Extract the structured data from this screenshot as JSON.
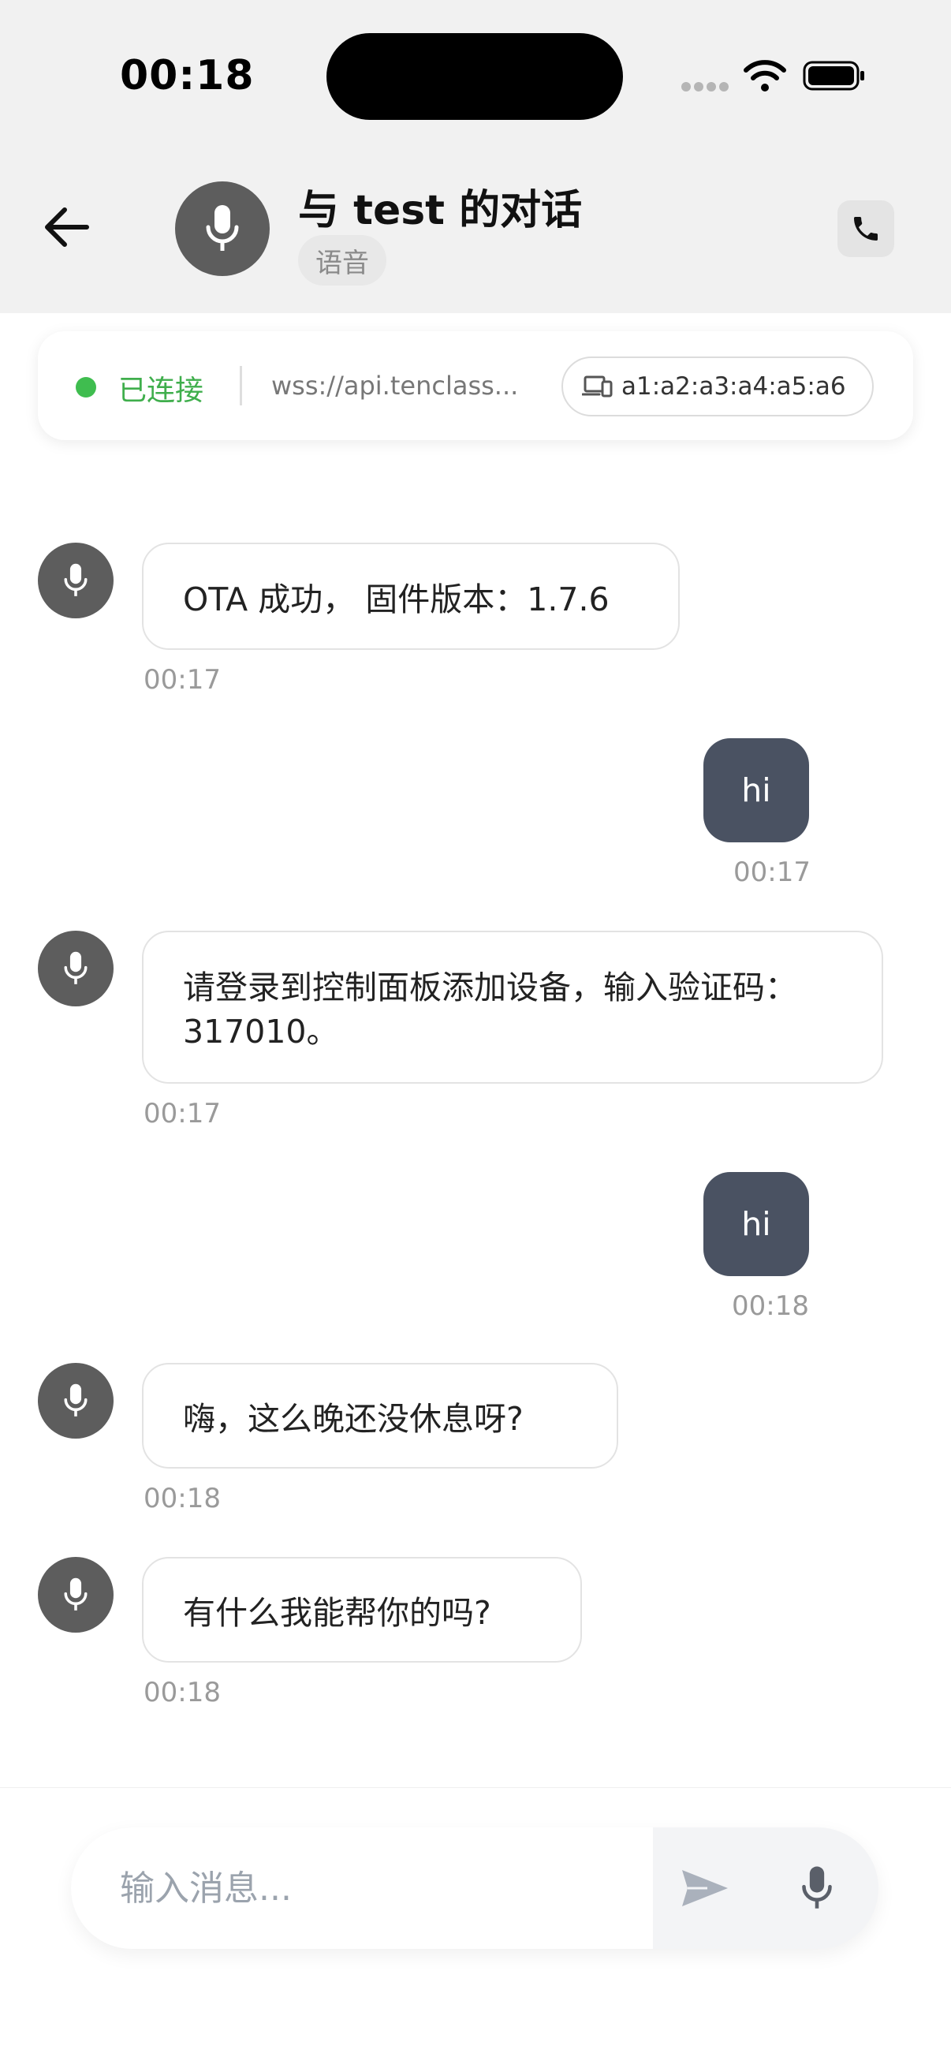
{
  "status_bar": {
    "time": "00:18"
  },
  "header": {
    "title": "与 test 的对话",
    "mode_chip": "语音",
    "icons": {
      "back": "arrow-left-icon",
      "avatar": "microphone-icon",
      "call": "phone-icon"
    }
  },
  "connection": {
    "status": "已连接",
    "status_color": "#3fbd4f",
    "url": "wss://api.tenclass...",
    "device_mac": "a1:a2:a3:a4:a5:a6",
    "device_icon": "devices-icon"
  },
  "messages": [
    {
      "from": "bot",
      "text": "OTA 成功， 固件版本：1.7.6",
      "time": "00:17"
    },
    {
      "from": "user",
      "text": "hi",
      "time": "00:17"
    },
    {
      "from": "bot",
      "text": "请登录到控制面板添加设备，输入验证码：317010。",
      "time": "00:17"
    },
    {
      "from": "user",
      "text": "hi",
      "time": "00:18"
    },
    {
      "from": "bot",
      "text": "嗨，这么晚还没休息呀?",
      "time": "00:18"
    },
    {
      "from": "bot",
      "text": "有什么我能帮你的吗?",
      "time": "00:18"
    }
  ],
  "composer": {
    "placeholder": "输入消息...",
    "icons": {
      "send": "send-icon",
      "mic": "microphone-icon"
    }
  },
  "colors": {
    "user_bubble": "#4a5262",
    "avatar_bg": "#5d5d5d",
    "header_bg": "#f1f1f1",
    "connected_green": "#3fbd4f"
  }
}
